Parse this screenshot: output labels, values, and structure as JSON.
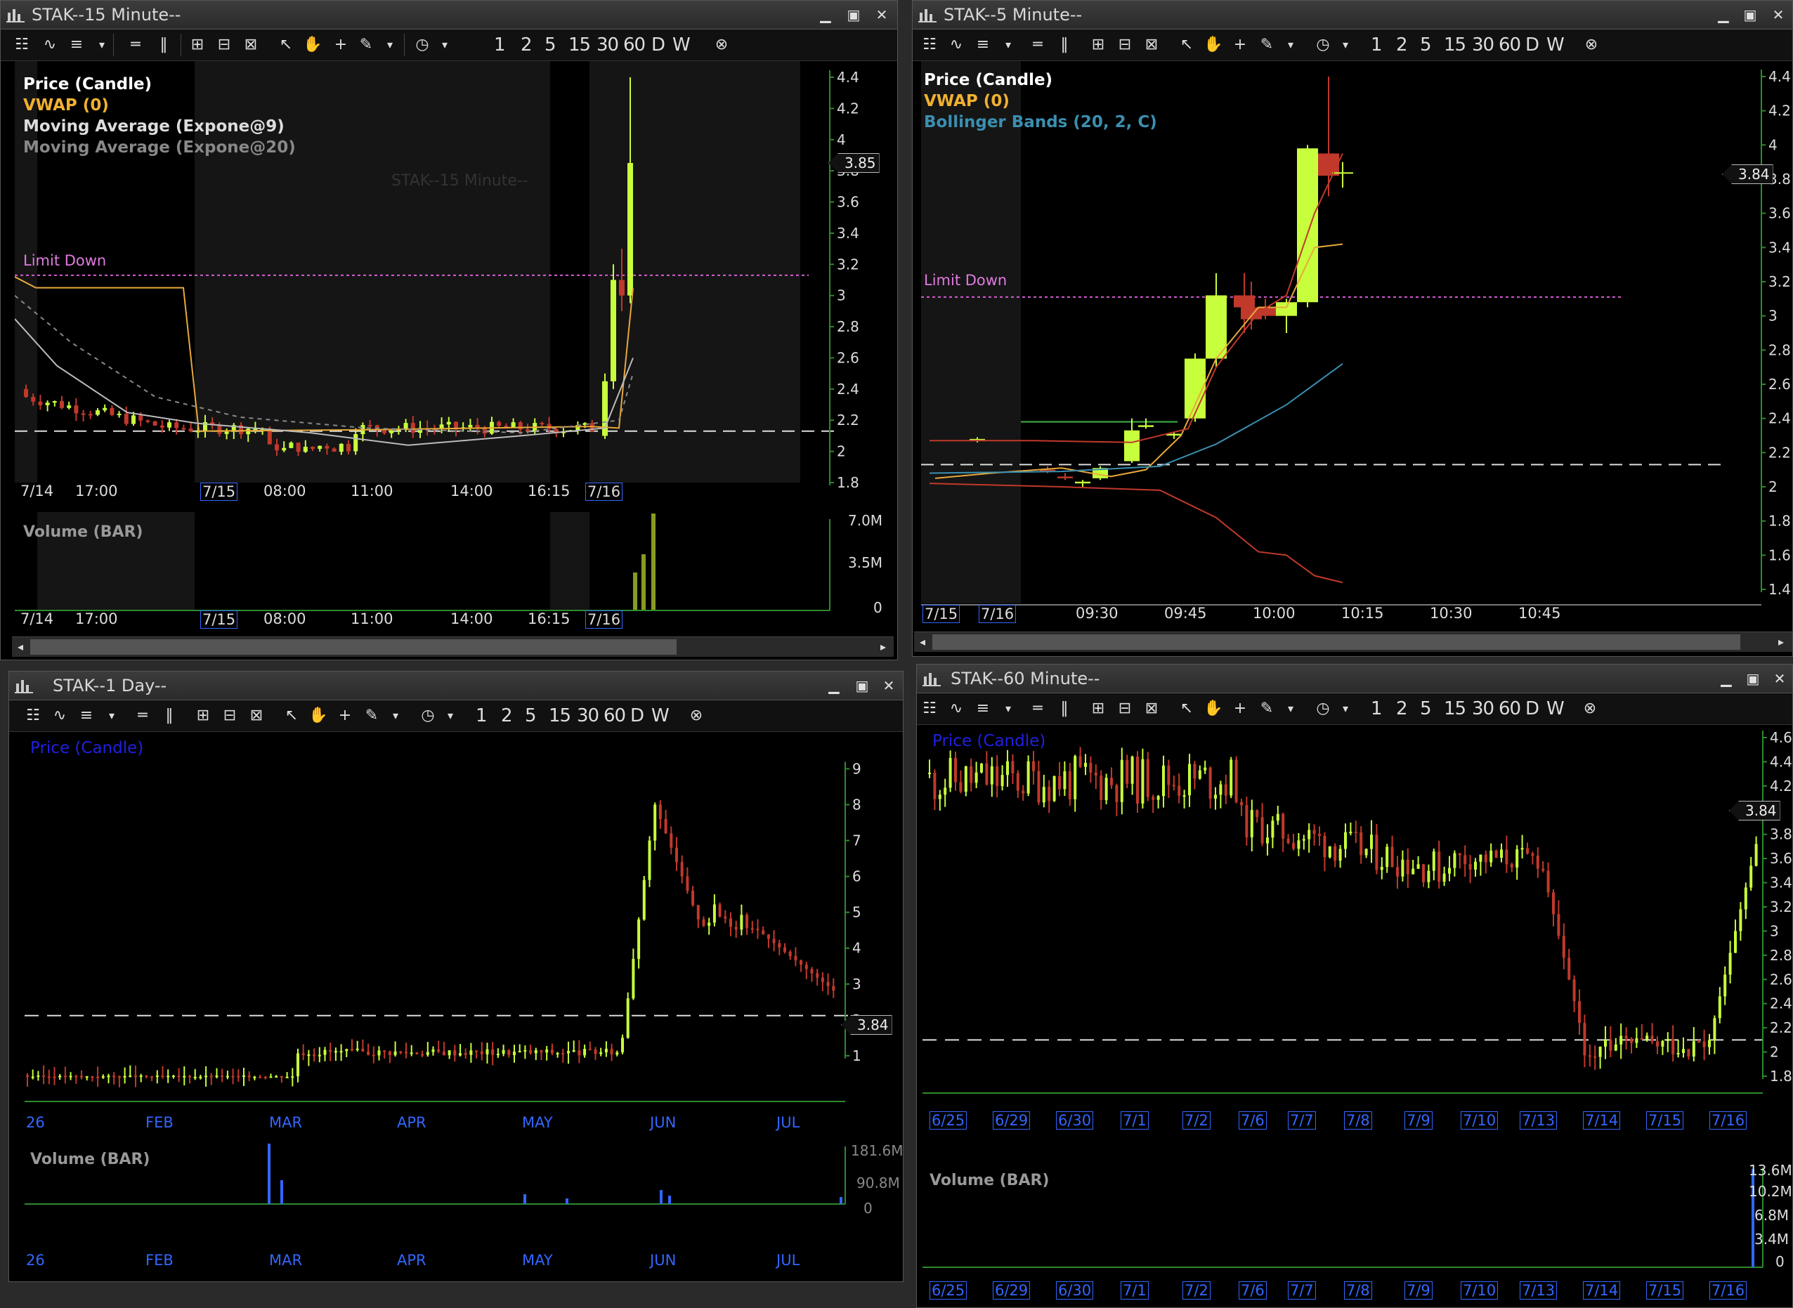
{
  "windows": {
    "w15": {
      "title": "STAK--15 Minute--"
    },
    "w5": {
      "title": "STAK--5 Minute--"
    },
    "w1d": {
      "title": "STAK--1 Day--"
    },
    "w60": {
      "title": "STAK--60 Minute--"
    }
  },
  "toolbar": {
    "periods": [
      "1",
      "2",
      "5",
      "15",
      "30",
      "60",
      "D",
      "W"
    ]
  },
  "chart15": {
    "legend": [
      "Price (Candle)",
      "VWAP (0)",
      "Moving Average (Expone@9)",
      "Moving Average (Expone@20)"
    ],
    "watermark": "STAK--15 Minute--",
    "limit_label": "Limit Down",
    "last_price": "3.85",
    "y_ticks": [
      "4.4",
      "4.2",
      "4",
      "3.8",
      "3.6",
      "3.4",
      "3.2",
      "3",
      "2.8",
      "2.6",
      "2.4",
      "2.2",
      "2",
      "1.8"
    ],
    "x_ticks": [
      "7/14",
      "17:00",
      "7/15",
      "08:00",
      "11:00",
      "14:00",
      "16:15",
      "7/16"
    ],
    "volume_label": "Volume (BAR)",
    "vol_ticks": [
      "7.0M",
      "3.5M",
      "0"
    ]
  },
  "chart5": {
    "legend": [
      "Price (Candle)",
      "VWAP (0)",
      "Bollinger Bands (20, 2, C)"
    ],
    "limit_label": "Limit Down",
    "last_price": "3.84",
    "y_ticks": [
      "4.4",
      "4.2",
      "4",
      "3.8",
      "3.6",
      "3.4",
      "3.2",
      "3",
      "2.8",
      "2.6",
      "2.4",
      "2.2",
      "2",
      "1.8",
      "1.6",
      "1.4"
    ],
    "x_ticks": [
      "7/15",
      "7/16",
      "09:30",
      "09:45",
      "10:00",
      "10:15",
      "10:30",
      "10:45"
    ]
  },
  "chart1d": {
    "legend": [
      "Price (Candle)"
    ],
    "last_price": "3.84",
    "y_ticks": [
      "9",
      "8",
      "7",
      "6",
      "5",
      "4",
      "3",
      "2",
      "1"
    ],
    "x_ticks": [
      "26",
      "FEB",
      "MAR",
      "APR",
      "MAY",
      "JUN",
      "JUL"
    ],
    "volume_label": "Volume (BAR)",
    "vol_ticks": [
      "181.6M",
      "90.8M",
      "0"
    ]
  },
  "chart60": {
    "legend": [
      "Price (Candle)"
    ],
    "last_price": "3.84",
    "y_ticks": [
      "4.6",
      "4.4",
      "4.2",
      "4",
      "3.8",
      "3.6",
      "3.4",
      "3.2",
      "3",
      "2.8",
      "2.6",
      "2.4",
      "2.2",
      "2",
      "1.8"
    ],
    "x_ticks": [
      "6/25",
      "6/29",
      "6/30",
      "7/1",
      "7/2",
      "7/6",
      "7/7",
      "7/8",
      "7/9",
      "7/10",
      "7/13",
      "7/14",
      "7/15",
      "7/16"
    ],
    "volume_label": "Volume (BAR)",
    "vol_ticks": [
      "13.6M",
      "10.2M",
      "6.8M",
      "3.4M",
      "0"
    ]
  },
  "colors": {
    "up": "#c8ff3c",
    "down": "#c0392b",
    "vwap": "#e8a93a",
    "limit": "#d65cd6",
    "bb": "#3a8fb0",
    "grid_axis": "#2d8a2d"
  }
}
